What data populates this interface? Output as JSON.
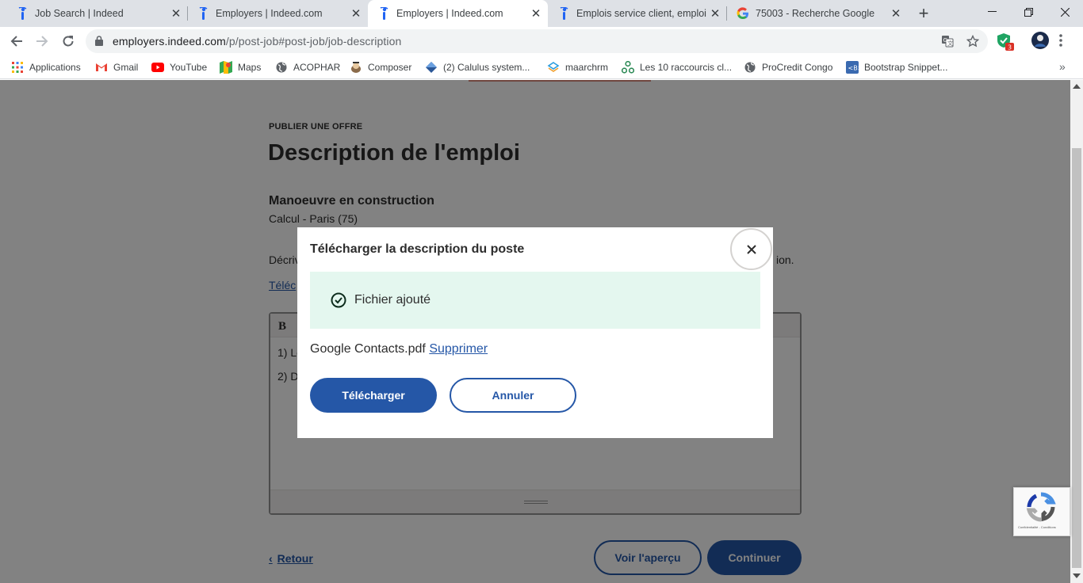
{
  "browser": {
    "tabs": [
      {
        "title": "Job Search | Indeed",
        "icon": "indeed-icon",
        "active": false
      },
      {
        "title": "Employers | Indeed.com",
        "icon": "indeed-icon",
        "active": false
      },
      {
        "title": "Employers | Indeed.com",
        "icon": "indeed-icon",
        "active": true
      },
      {
        "title": "Emplois service client, emploi |",
        "icon": "indeed-icon",
        "active": false
      },
      {
        "title": "75003 - Recherche Google",
        "icon": "google-icon",
        "active": false
      }
    ],
    "address": {
      "host": "employers.indeed.com",
      "path": "/p/post-job#post-job/job-description"
    },
    "extension_badge": "3",
    "bookmarks": [
      {
        "label": "Applications",
        "icon": "apps-grid-icon"
      },
      {
        "label": "Gmail",
        "icon": "gmail-icon"
      },
      {
        "label": "YouTube",
        "icon": "youtube-icon"
      },
      {
        "label": "Maps",
        "icon": "maps-icon"
      },
      {
        "label": "ACOPHAR",
        "icon": "globe-icon"
      },
      {
        "label": "Composer",
        "icon": "composer-icon"
      },
      {
        "label": "(2) Calulus system...",
        "icon": "calculus-icon"
      },
      {
        "label": "maarchrm",
        "icon": "maarch-icon"
      },
      {
        "label": "Les 10 raccourcis cl...",
        "icon": "network-icon"
      },
      {
        "label": "ProCredit Congo",
        "icon": "globe-icon"
      },
      {
        "label": "Bootstrap Snippet...",
        "icon": "bootstrap-icon"
      }
    ],
    "more_bookmarks": "»"
  },
  "page": {
    "eyebrow": "PUBLIER UNE OFFRE",
    "heading": "Description de l'emploi",
    "job_title": "Manoeuvre en construction",
    "job_meta": "Calcul  -  Paris (75)",
    "description_start": "Décriv",
    "description_end": "ion.",
    "upload_link_partial": "Téléc",
    "editor": {
      "bold_button": "B",
      "line1": "1) Le",
      "line2": "2) D"
    },
    "back_label": "Retour",
    "preview_label": "Voir l'aperçu",
    "continue_label": "Continuer"
  },
  "modal": {
    "title": "Télécharger la description du poste",
    "success_message": "Fichier ajouté",
    "file_name": "Google Contacts.pdf",
    "delete_link": "Supprimer",
    "upload_button": "Télécharger",
    "cancel_button": "Annuler"
  },
  "recaptcha": {
    "text": "Confidentialité - Conditions"
  },
  "colors": {
    "indeed_blue": "#2557a7",
    "success_bg": "#e4f7ef",
    "text": "#2d2d2d"
  }
}
